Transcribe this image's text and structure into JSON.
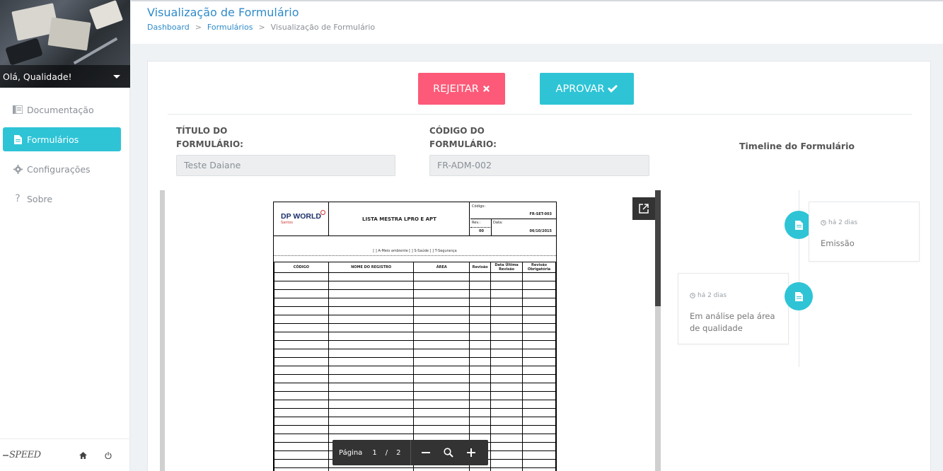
{
  "sidebar": {
    "greeting": "Olá, Qualidade!",
    "items": [
      {
        "label": "Documentação",
        "icon": "book-icon",
        "active": false
      },
      {
        "label": "Formulários",
        "icon": "file-icon",
        "active": true
      },
      {
        "label": "Configurações",
        "icon": "gear-icon",
        "active": false
      },
      {
        "label": "Sobre",
        "icon": "question-icon",
        "active": false
      }
    ],
    "footer": {
      "logo": "SPEED",
      "home_icon": "home-icon",
      "power_icon": "power-icon"
    }
  },
  "header": {
    "title": "Visualização de Formulário",
    "breadcrumb": [
      "Dashboard",
      "Formulários",
      "Visualização de Formulário"
    ]
  },
  "actions": {
    "reject_label": "REJEITAR",
    "approve_label": "APROVAR"
  },
  "form": {
    "title_label_1": "TÍTULO DO",
    "title_label_2": "FORMULÁRIO:",
    "title_value": "Teste Daiane",
    "code_label_1": "CÓDIGO DO",
    "code_label_2": "FORMULÁRIO:",
    "code_value": "FR-ADM-002"
  },
  "document": {
    "logo_text": "DP WORLD",
    "logo_sub": "Santos",
    "title": "LISTA MESTRA LPRO E APT",
    "codigo_label": "Código:",
    "codigo_value": "FR-SET-003",
    "rev_label": "Rev.:",
    "rev_value": "00",
    "data_label": "Data:",
    "data_value": "06/10/2015",
    "legend": "[ ] A-Meio ambiente  [ ] S-Saúde  [ ] T-Segurança",
    "columns": [
      "CÓDIGO",
      "NOME DO REGISTRO",
      "ÁREA",
      "Revisão",
      "Data Última Revisão",
      "Revisão Obrigatória"
    ]
  },
  "pdf_toolbar": {
    "page_label": "Página",
    "current_page": "1",
    "separator": "/",
    "total_pages": "2"
  },
  "timeline": {
    "title": "Timeline do Formulário",
    "events": [
      {
        "time": "há 2 dias",
        "text": "Emissão"
      },
      {
        "time": "há 2 dias",
        "text_line1": "Em análise pela área",
        "text_line2": "de qualidade"
      }
    ]
  },
  "colors": {
    "accent": "#2ec4d6",
    "reject": "#fc5a78",
    "link": "#2f8bc9"
  }
}
